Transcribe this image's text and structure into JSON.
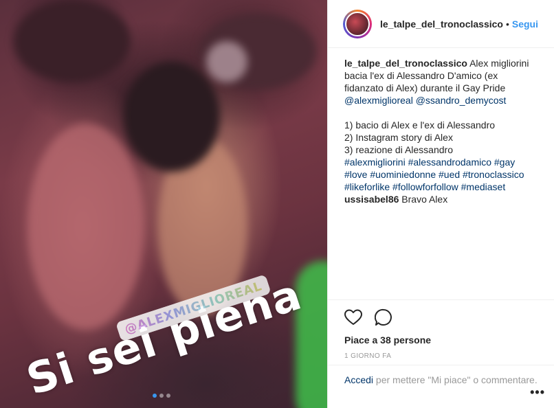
{
  "post": {
    "username": "le_talpe_del_tronoclassico",
    "separator": "•",
    "follow_label": "Segui"
  },
  "media": {
    "overlay_text": "Si sei piena",
    "mention_sticker": "@ALEXMIGLIOREAL",
    "carousel_dots": 3,
    "active_dot": 0
  },
  "caption": {
    "username": "le_talpe_del_tronoclassico",
    "text_1": " Alex migliorini bacia l'ex di Alessandro D'amico (ex fidanzato di Alex) durante il Gay Pride",
    "mention_1": "@alexmiglioreal",
    "mention_2": "@ssandro_demycost",
    "item_1": "1) bacio di Alex e l'ex di Alessandro",
    "item_2": "2) Instagram story di Alex",
    "item_3": "3) reazione di Alessandro",
    "hashtags": [
      "#alexmigliorini",
      "#alessandrodamico",
      "#gay",
      "#love",
      "#uominiedonne",
      "#ued",
      "#tronoclassico",
      "#likeforlike",
      "#followforfollow",
      "#mediaset"
    ]
  },
  "comments": [
    {
      "username": "ussisabel86",
      "text": "Bravo Alex"
    }
  ],
  "actions": {
    "likes_text": "Piace a 38 persone",
    "time_ago": "1 GIORNO FA"
  },
  "comment_box": {
    "login_link": "Accedi",
    "prompt": " per mettere \"Mi piace\" o commentare.",
    "more_label": "•••"
  },
  "colors": {
    "link_blue": "#3897f0",
    "hashtag_blue": "#003569",
    "text": "#262626",
    "muted": "#999999"
  }
}
